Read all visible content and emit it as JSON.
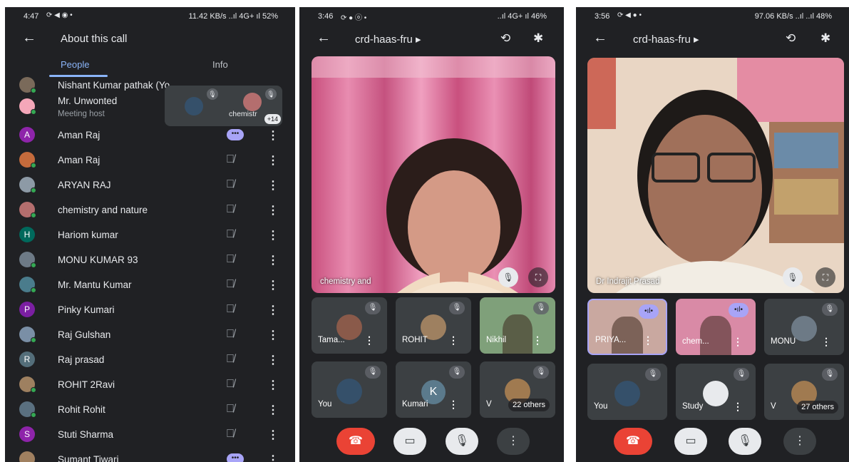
{
  "panel1": {
    "status": {
      "time": "4:47",
      "right": "11.42 KB/s ..ıl 4G+ ıl 52%"
    },
    "header": {
      "title": "About this call"
    },
    "tabs": {
      "people": "People",
      "info": "Info"
    },
    "people": [
      {
        "name": "Nishant Kumar pathak (Yo...",
        "avatar": "photo",
        "color": "#7a6a5a"
      },
      {
        "name": "Mr. Unwonted",
        "sub": "Meeting host",
        "avatar": "photo",
        "color": "#f4a7b9"
      },
      {
        "name": "Aman Raj",
        "avatar": "A",
        "color": "#8e24aa",
        "state": "speaking"
      },
      {
        "name": "Aman Raj",
        "avatar": "photo",
        "color": "#c56b3c",
        "state": "muted"
      },
      {
        "name": "ARYAN RAJ",
        "avatar": "photo",
        "color": "#8d9aa6",
        "state": "muted"
      },
      {
        "name": "chemistry and nature",
        "avatar": "photo",
        "color": "#b46e6e",
        "state": "muted"
      },
      {
        "name": "Hariom kumar",
        "avatar": "H",
        "color": "#00695c",
        "state": "muted"
      },
      {
        "name": "MONU KUMAR 93",
        "avatar": "photo",
        "color": "#6d7a86",
        "state": "muted"
      },
      {
        "name": "Mr. Mantu Kumar",
        "avatar": "photo",
        "color": "#4a7c8c",
        "state": "muted"
      },
      {
        "name": "Pinky Kumari",
        "avatar": "P",
        "color": "#7b1fa2",
        "state": "muted"
      },
      {
        "name": "Raj Gulshan",
        "avatar": "photo",
        "color": "#7a8fa6",
        "state": "muted"
      },
      {
        "name": "Raj prasad",
        "avatar": "R",
        "color": "#546e7a",
        "state": "muted"
      },
      {
        "name": "ROHIT 2Ravi",
        "avatar": "photo",
        "color": "#9e8060",
        "state": "muted"
      },
      {
        "name": "Rohit Rohit",
        "avatar": "photo",
        "color": "#5a7080",
        "state": "muted"
      },
      {
        "name": "Stuti Sharma",
        "avatar": "S",
        "color": "#8e24aa",
        "state": "muted"
      },
      {
        "name": "Sumant Tiwari",
        "avatar": "photo",
        "color": "#a08060",
        "state": "speaking"
      }
    ],
    "pip": {
      "label": "chemistr",
      "badge": "+14"
    }
  },
  "panel2": {
    "status": {
      "time": "3:46",
      "right": "..ıl 4G+ ıl 46%"
    },
    "header": {
      "title": "crd-haas-fru ▸"
    },
    "main_label": "chemistry and",
    "tiles": [
      {
        "name": "Tama...",
        "type": "avatar",
        "color": "#8a5a4a"
      },
      {
        "name": "ROHIT",
        "type": "avatar",
        "color": "#9e8060"
      },
      {
        "name": "Nikhil",
        "type": "video",
        "color": "#7fa07a"
      },
      {
        "name": "You",
        "type": "avatar",
        "color": "#35506a"
      },
      {
        "name": "Kumari",
        "type": "letter",
        "letter": "K"
      },
      {
        "name": "V",
        "type": "avatar",
        "color": "#a07a50",
        "others": "22 others"
      }
    ]
  },
  "panel3": {
    "status": {
      "time": "3:56",
      "right": "97.06 KB/s ..ıl ..ıl 48%"
    },
    "header": {
      "title": "crd-haas-fru ▸"
    },
    "main_label": "Dr Indrajit Prasad",
    "tiles": [
      {
        "name": "PRIYA...",
        "type": "video",
        "color": "#c9a8a0",
        "speaking": true
      },
      {
        "name": "chem...",
        "type": "video",
        "color": "#d98aa6",
        "speaking": true
      },
      {
        "name": "MONU",
        "type": "avatar",
        "color": "#6d7a86"
      },
      {
        "name": "You",
        "type": "avatar",
        "color": "#35506a"
      },
      {
        "name": "Study",
        "type": "avatar",
        "color": "#e8eaed"
      },
      {
        "name": "V",
        "type": "avatar",
        "color": "#a07a50",
        "others": "27 others"
      }
    ]
  }
}
